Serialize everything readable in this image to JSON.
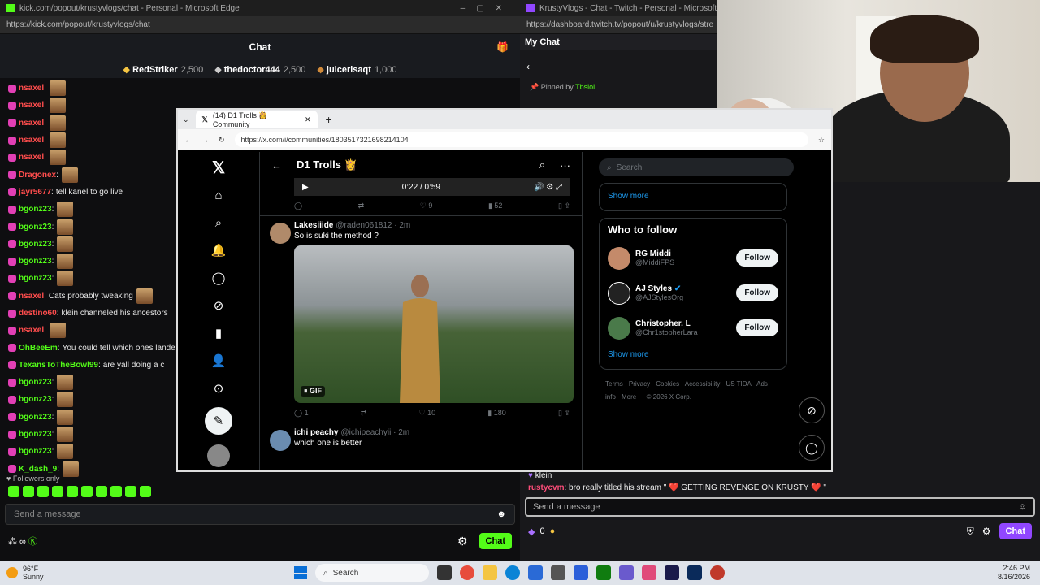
{
  "kick": {
    "title": "kick.com/popout/krustyvlogs/chat - Personal - Microsoft Edge",
    "url": "https://kick.com/popout/krustyvlogs/chat",
    "header": "Chat",
    "leaderboard": [
      {
        "name": "RedStriker",
        "amount": "2,500"
      },
      {
        "name": "thedoctor444",
        "amount": "2,500"
      },
      {
        "name": "juicerisaqt",
        "amount": "1,000"
      }
    ],
    "messages": [
      {
        "user": "nsaxel",
        "color": "#ff4d4d",
        "text": "",
        "emote": true
      },
      {
        "user": "nsaxel",
        "color": "#ff4d4d",
        "text": "",
        "emote": true
      },
      {
        "user": "nsaxel",
        "color": "#ff4d4d",
        "text": "",
        "emote": true
      },
      {
        "user": "nsaxel",
        "color": "#ff4d4d",
        "text": "",
        "emote": true
      },
      {
        "user": "nsaxel",
        "color": "#ff4d4d",
        "text": "",
        "emote": true
      },
      {
        "user": "Dragonex",
        "color": "#ff4d4d",
        "text": "",
        "emote": true
      },
      {
        "user": "jayr5677",
        "color": "#ff4d4d",
        "text": "tell kanel to go live",
        "emote": false
      },
      {
        "user": "bgonz23",
        "color": "#53fc18",
        "text": "",
        "emote": true
      },
      {
        "user": "bgonz23",
        "color": "#53fc18",
        "text": "",
        "emote": true
      },
      {
        "user": "bgonz23",
        "color": "#53fc18",
        "text": "",
        "emote": true
      },
      {
        "user": "bgonz23",
        "color": "#53fc18",
        "text": "",
        "emote": true
      },
      {
        "user": "bgonz23",
        "color": "#53fc18",
        "text": "",
        "emote": true
      },
      {
        "user": "nsaxel",
        "color": "#ff4d4d",
        "text": "Cats probably tweaking",
        "emote": true
      },
      {
        "user": "destino60",
        "color": "#ff4d4d",
        "text": "klein channeled his ancestors",
        "emote": false
      },
      {
        "user": "nsaxel",
        "color": "#ff4d4d",
        "text": "",
        "emote": true
      },
      {
        "user": "OhBeeEm",
        "color": "#53fc18",
        "text": "You could tell which ones lande",
        "emote": false
      },
      {
        "user": "TexansToTheBowl99",
        "color": "#53fc18",
        "text": "are yall doing a c",
        "emote": false
      },
      {
        "user": "bgonz23",
        "color": "#53fc18",
        "text": "",
        "emote": true
      },
      {
        "user": "bgonz23",
        "color": "#53fc18",
        "text": "",
        "emote": true
      },
      {
        "user": "bgonz23",
        "color": "#53fc18",
        "text": "",
        "emote": true
      },
      {
        "user": "bgonz23",
        "color": "#53fc18",
        "text": "",
        "emote": true
      },
      {
        "user": "bgonz23",
        "color": "#53fc18",
        "text": "",
        "emote": true
      },
      {
        "user": "K_dash_9",
        "color": "#53fc18",
        "text": "",
        "emote": true
      }
    ],
    "followers_only": "Followers only",
    "input_placeholder": "Send a message",
    "chat_button": "Chat"
  },
  "twitch": {
    "title": "KrustyVlogs - Chat - Twitch - Personal - Microsoft Edge",
    "url": "https://dashboard.twitch.tv/popout/u/krustyvlogs/stre",
    "header": "My Chat",
    "pinned": "Pinned by",
    "pinned_user": "Tbslol",
    "lines": [
      {
        "user": "",
        "text": "klein"
      },
      {
        "user": "rustycvm",
        "text": "bro really titled his stream \" ❤️ GETTING REVENGE ON KRUSTY ❤️ \""
      }
    ],
    "input_placeholder": "Send a message",
    "points": "0",
    "chat_button": "Chat"
  },
  "xwin": {
    "tab_title": "(14) D1 Trolls 👸 Community",
    "url": "https://x.com/i/communities/1803517321698214104",
    "page_title": "D1 Trolls 👸",
    "video_time": "0:22 / 0:59",
    "top_actions": {
      "likes": "9",
      "views": "52"
    },
    "post": {
      "display_name": "Lakesiiide",
      "handle": "@raden061812 · 2m",
      "text": "So is suki the method ?",
      "gif_label": "GIF",
      "replies": "1",
      "likes": "10",
      "views": "180"
    },
    "next_post": {
      "display_name": "ichi peachy",
      "handle": "@ichipeachyii · 2m",
      "text": "which one is better"
    },
    "search_placeholder": "Search",
    "show_more": "Show more",
    "who_to_follow": "Who to follow",
    "follow_label": "Follow",
    "suggestions": [
      {
        "name": "RG Middi",
        "handle": "@MiddiFPS"
      },
      {
        "name": "AJ Styles",
        "handle": "@AJStylesOrg"
      },
      {
        "name": "Christopher. L",
        "handle": "@Chr1stopherLara"
      }
    ],
    "footer": "Terms · Privacy · Cookies · Accessibility · US TIDA · Ads info · More ··· © 2026 X Corp."
  },
  "taskbar": {
    "temp": "96°F",
    "weather": "Sunny",
    "search": "Search",
    "time": "2:46 PM",
    "date": "8/16/2026"
  }
}
